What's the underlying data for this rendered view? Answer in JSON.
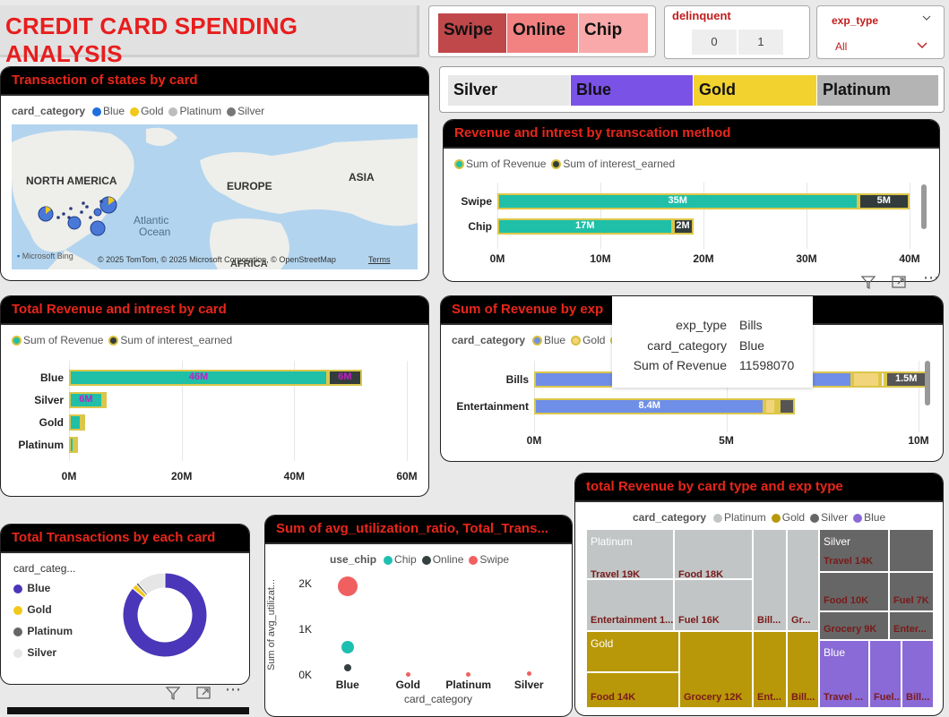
{
  "page_title": "CREDIT CARD SPENDING ANALYSIS",
  "slicers": {
    "use_chip": {
      "items": [
        "Swipe",
        "Online",
        "Chip"
      ],
      "colors": [
        "#c0474a",
        "#f28282",
        "#f9a9a9"
      ]
    },
    "delinquent": {
      "label": "delinquent",
      "items": [
        "0",
        "1"
      ]
    },
    "exp_type": {
      "label": "exp_type",
      "selected": "All"
    },
    "card_category": {
      "items": [
        "Silver",
        "Blue",
        "Gold",
        "Platinum"
      ],
      "colors": [
        "#e8e8e8",
        "#7b52e6",
        "#f2d22e",
        "#b4b4b4"
      ]
    }
  },
  "map": {
    "title": "Transaction of states by card",
    "legend_title": "card_category",
    "legend": [
      "Blue",
      "Gold",
      "Platinum",
      "Silver"
    ],
    "legend_colors": [
      "#1f6fe0",
      "#f2c81a",
      "#bdbdbd",
      "#777777"
    ],
    "labels": {
      "na": "NORTH AMERICA",
      "eu": "EUROPE",
      "asia": "ASIA",
      "atl1": "Atlantic",
      "atl2": "Ocean",
      "africa": "AFRICA"
    },
    "brand": "Microsoft Bing",
    "copyright": "© 2025 TomTom, © 2025 Microsoft Corporation, © OpenStreetMap",
    "terms": "Terms"
  },
  "rev_method": {
    "title": "Revenue and intrest by transcation method",
    "legend": [
      "Sum of Revenue",
      "Sum of interest_earned"
    ]
  },
  "rev_card": {
    "title": "Total Revenue and intrest by card",
    "legend": [
      "Sum of Revenue",
      "Sum of interest_earned"
    ]
  },
  "rev_exp": {
    "title": "Sum of Revenue by exp",
    "legend_title": "card_category",
    "legend": [
      "Blue",
      "Gold"
    ]
  },
  "tooltip": {
    "rows": [
      {
        "k": "exp_type",
        "v": "Bills"
      },
      {
        "k": "card_category",
        "v": "Blue"
      },
      {
        "k": "Sum of Revenue",
        "v": "11598070"
      }
    ]
  },
  "donut": {
    "title": "Total Transactions by each card",
    "legend_title": "card_categ...",
    "legend": [
      "Blue",
      "Gold",
      "Platinum",
      "Silver"
    ],
    "colors": [
      "#4a36b8",
      "#f2c81a",
      "#666666",
      "#e6e6e6"
    ]
  },
  "scatter": {
    "title": "Sum of avg_utilization_ratio, Total_Trans...",
    "legend_title": "use_chip",
    "legend": [
      "Chip",
      "Online",
      "Swipe"
    ],
    "legend_colors": [
      "#1fbfb0",
      "#33403f",
      "#f06060"
    ]
  },
  "treemap": {
    "title": "total Revenue by card type and exp type",
    "legend_title": "card_category",
    "legend": [
      "Platinum",
      "Gold",
      "Silver",
      "Blue"
    ],
    "legend_colors": [
      "#c1c5c5",
      "#b89808",
      "#666666",
      "#8a6ad6"
    ],
    "cells": {
      "platinum": "Platinum",
      "p_travel": "Travel 19K",
      "p_food": "Food 18K",
      "p_ent": "Entertainment 1...",
      "p_fuel": "Fuel 16K",
      "p_bill": "Bill...",
      "p_gr": "Gr...",
      "silver": "Silver",
      "s_travel": "Travel 14K",
      "s_food": "Food 10K",
      "s_fuel": "Fuel 7K",
      "s_grocery": "Grocery 9K",
      "s_ent": "Enter...",
      "gold": "Gold",
      "g_food": "Food 14K",
      "g_grocery": "Grocery 12K",
      "g_ent": "Ent...",
      "g_bill": "Bill...",
      "blue": "Blue",
      "b_travel": "Travel ...",
      "b_fuel": "Fuel...",
      "b_bill": "Bill..."
    }
  },
  "chart_data": [
    {
      "type": "bar",
      "title": "Revenue and intrest by transcation method",
      "orientation": "horizontal",
      "stacked": true,
      "categories": [
        "Swipe",
        "Chip"
      ],
      "series": [
        {
          "name": "Sum of Revenue",
          "values": [
            35,
            17
          ],
          "labels": [
            "35M",
            "17M"
          ],
          "color": "#1fbfa8"
        },
        {
          "name": "Sum of interest_earned",
          "values": [
            5,
            2
          ],
          "labels": [
            "5M",
            "2M"
          ],
          "color": "#333c3c"
        }
      ],
      "xticks": [
        "0M",
        "10M",
        "20M",
        "30M",
        "40M"
      ],
      "xlim": [
        0,
        40
      ]
    },
    {
      "type": "bar",
      "title": "Total Revenue and intrest by card",
      "orientation": "horizontal",
      "stacked": true,
      "categories": [
        "Blue",
        "Silver",
        "Gold",
        "Platinum"
      ],
      "series": [
        {
          "name": "Sum of Revenue",
          "values": [
            46,
            6,
            2.2,
            1
          ],
          "labels": [
            "46M",
            "6M",
            "",
            ""
          ],
          "color": "#1fbfa8"
        },
        {
          "name": "Sum of interest_earned",
          "values": [
            6,
            0.5,
            0.3,
            0.2
          ],
          "labels": [
            "6M",
            "",
            "",
            ""
          ],
          "color": "#333c3c"
        }
      ],
      "xticks": [
        "0M",
        "20M",
        "40M",
        "60M"
      ],
      "xlim": [
        0,
        60
      ]
    },
    {
      "type": "bar",
      "title": "Sum of Revenue by exp",
      "orientation": "horizontal",
      "stacked": true,
      "categories": [
        "Bills",
        "Entertainment"
      ],
      "series": [
        {
          "name": "Blue",
          "values": [
            11.6,
            8.4
          ],
          "labels": [
            "",
            "8.4M"
          ],
          "color": "#6f8ee8"
        },
        {
          "name": "Gold",
          "values": [
            1.0,
            0.4
          ],
          "labels": [
            "",
            ""
          ],
          "color": "#f2d57a"
        },
        {
          "name": "",
          "values": [
            0.2,
            0.1
          ],
          "labels": [
            "",
            ""
          ],
          "color": "#eeeeee"
        },
        {
          "name": "",
          "values": [
            1.5,
            0.6
          ],
          "labels": [
            "1.5M",
            ""
          ],
          "color": "#555555"
        }
      ],
      "xticks": [
        "0M",
        "5M",
        "10M"
      ],
      "xlim": [
        0,
        14
      ]
    },
    {
      "type": "pie",
      "title": "Total Transactions by each card",
      "categories": [
        "Blue",
        "Gold",
        "Platinum",
        "Silver"
      ],
      "values": [
        86,
        2,
        1,
        11
      ],
      "donut": true
    },
    {
      "type": "scatter",
      "title": "Sum of avg_utilization_ratio, Total_Trans...",
      "xlabel": "card_category",
      "ylabel": "Sum of avg_utilizat...",
      "categories": [
        "Blue",
        "Gold",
        "Platinum",
        "Silver"
      ],
      "yticks": [
        "0K",
        "1K",
        "2K"
      ],
      "ylim": [
        0,
        2200
      ],
      "series": [
        {
          "name": "Chip",
          "points": [
            {
              "x": "Blue",
              "y": 600
            }
          ]
        },
        {
          "name": "Online",
          "points": [
            {
              "x": "Blue",
              "y": 150
            }
          ]
        },
        {
          "name": "Swipe",
          "points": [
            {
              "x": "Blue",
              "y": 1950
            },
            {
              "x": "Gold",
              "y": 10
            },
            {
              "x": "Platinum",
              "y": 10
            },
            {
              "x": "Silver",
              "y": 30
            }
          ]
        }
      ]
    }
  ]
}
